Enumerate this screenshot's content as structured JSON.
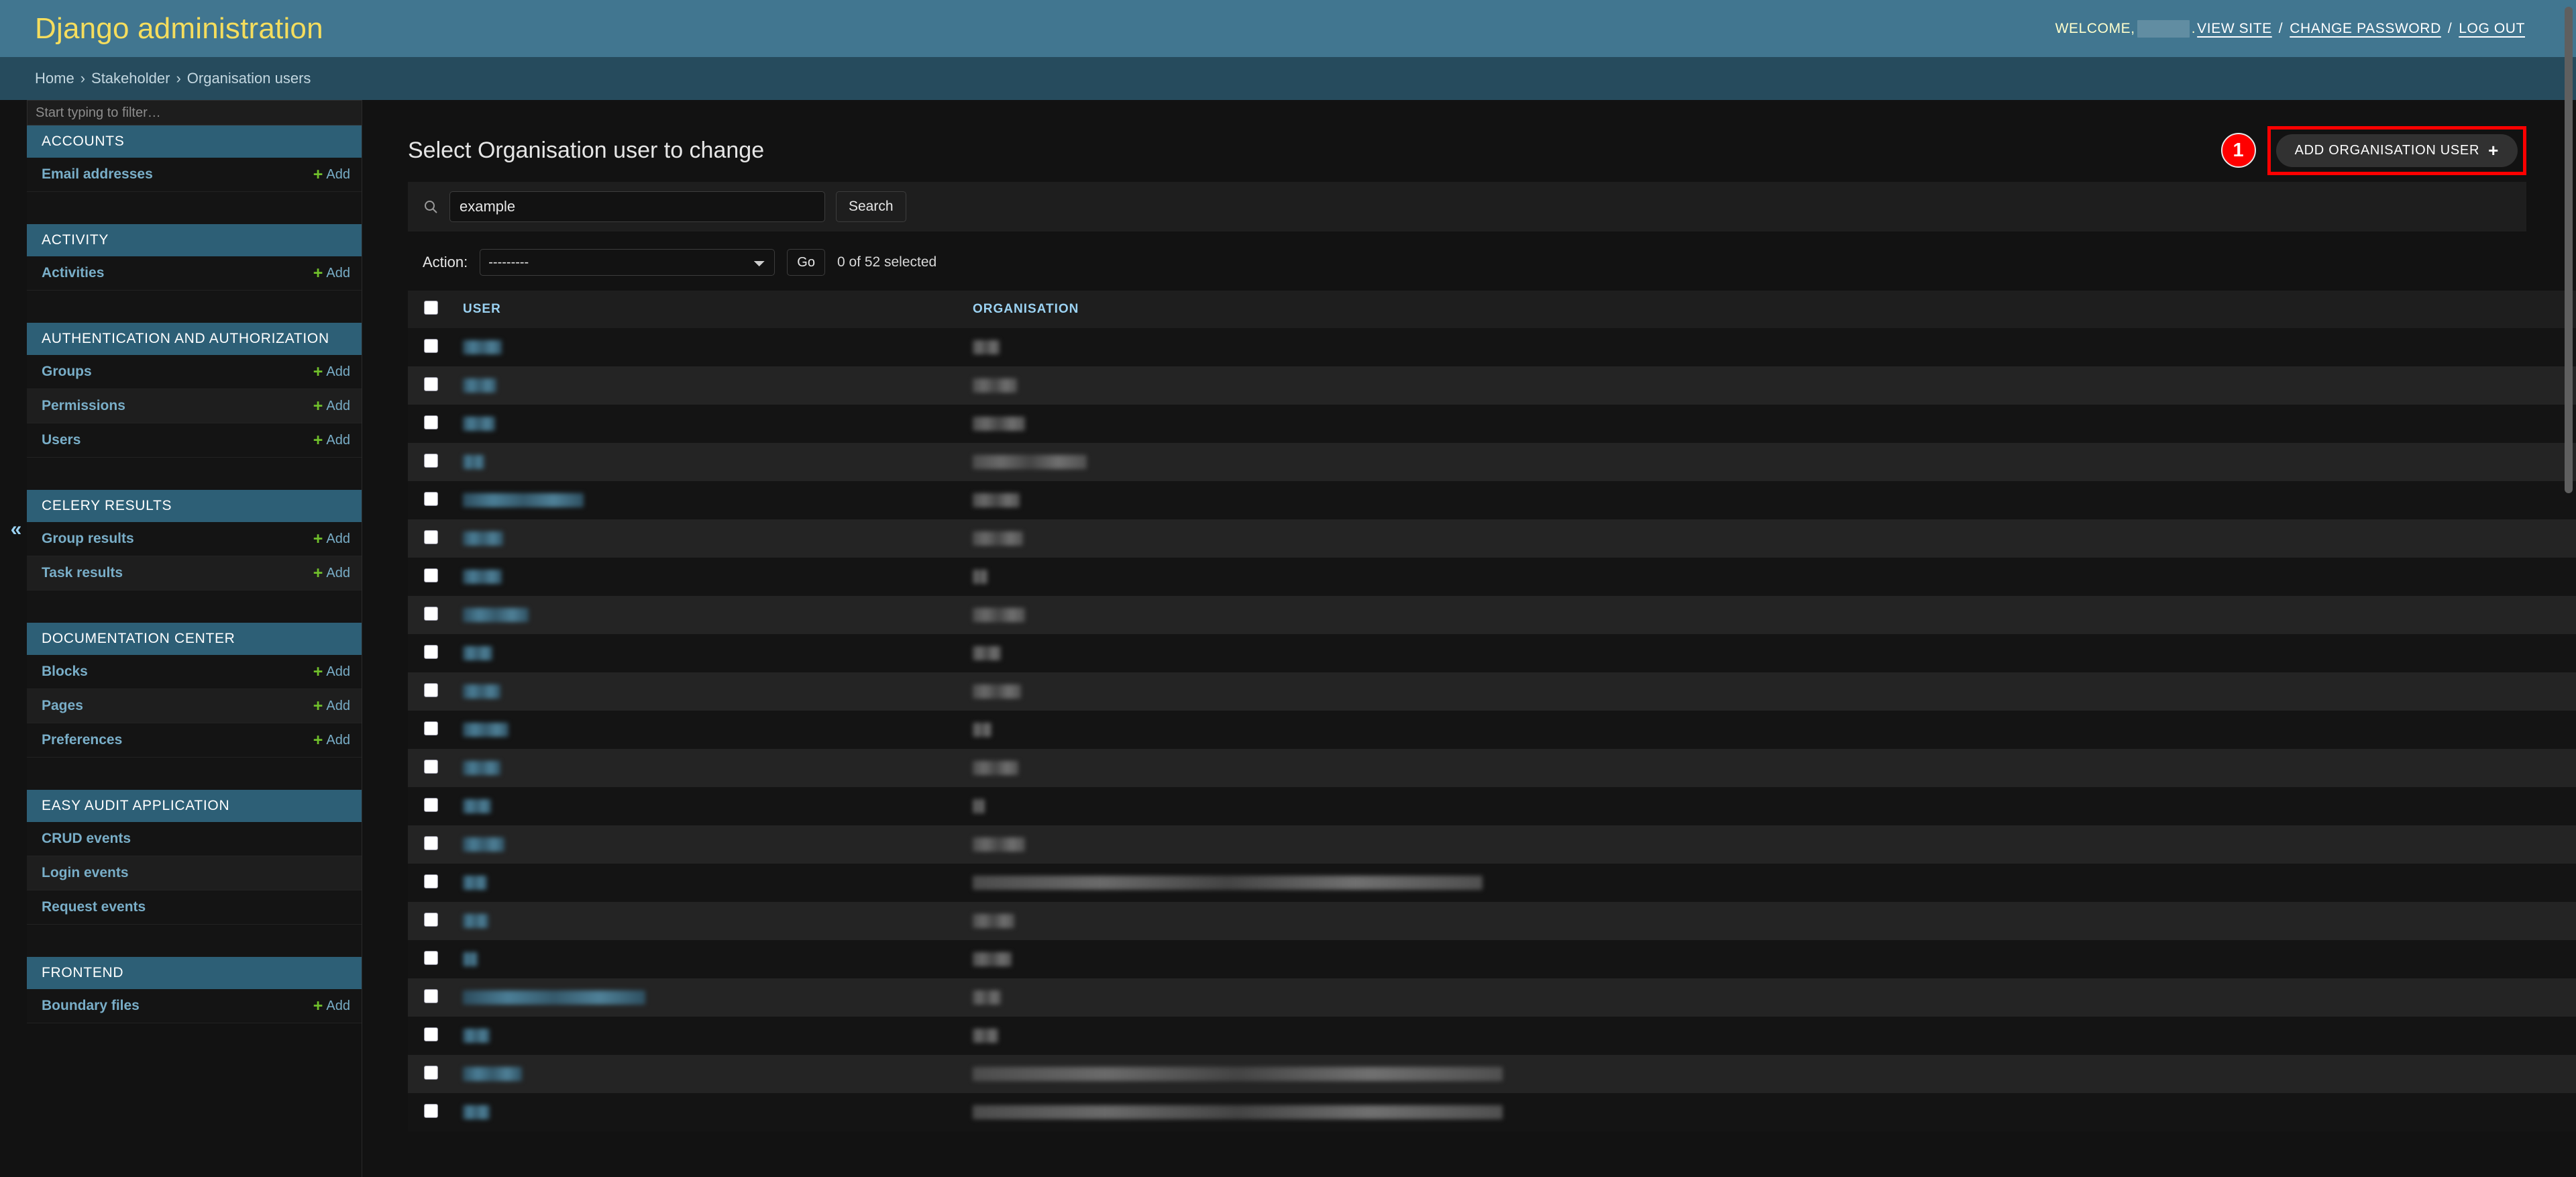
{
  "header": {
    "site_title": "Django administration",
    "welcome_text": "WELCOME,",
    "username_redacted": "",
    "view_site": "VIEW SITE",
    "change_password": "CHANGE PASSWORD",
    "log_out": "LOG OUT",
    "separator": "/",
    "brand_color": "#417690",
    "title_color": "#f5dd5d"
  },
  "breadcrumbs": {
    "home": "Home",
    "app": "Stakeholder",
    "current": "Organisation users",
    "separator": "›"
  },
  "sidebar": {
    "filter_placeholder": "Start typing to filter…",
    "filter_value": "",
    "collapse_icon": "«",
    "add_label": "Add",
    "plus_icon": "+",
    "apps": [
      {
        "caption": "ACCOUNTS",
        "models": [
          {
            "label": "Email addresses",
            "has_add": true
          }
        ]
      },
      {
        "caption": "ACTIVITY",
        "models": [
          {
            "label": "Activities",
            "has_add": true
          }
        ]
      },
      {
        "caption": "AUTHENTICATION AND AUTHORIZATION",
        "models": [
          {
            "label": "Groups",
            "has_add": true
          },
          {
            "label": "Permissions",
            "has_add": true
          },
          {
            "label": "Users",
            "has_add": true
          }
        ]
      },
      {
        "caption": "CELERY RESULTS",
        "models": [
          {
            "label": "Group results",
            "has_add": true
          },
          {
            "label": "Task results",
            "has_add": true
          }
        ]
      },
      {
        "caption": "DOCUMENTATION CENTER",
        "models": [
          {
            "label": "Blocks",
            "has_add": true
          },
          {
            "label": "Pages",
            "has_add": true
          },
          {
            "label": "Preferences",
            "has_add": true
          }
        ]
      },
      {
        "caption": "EASY AUDIT APPLICATION",
        "models": [
          {
            "label": "CRUD events",
            "has_add": false
          },
          {
            "label": "Login events",
            "has_add": false
          },
          {
            "label": "Request events",
            "has_add": false
          }
        ]
      },
      {
        "caption": "FRONTEND",
        "models": [
          {
            "label": "Boundary files",
            "has_add": true
          }
        ]
      }
    ]
  },
  "main": {
    "page_title": "Select Organisation user to change",
    "add_button_label": "ADD ORGANISATION USER",
    "add_button_plus": "+",
    "annotation_number": "1",
    "annotation_color": "#ff0000",
    "search": {
      "value": "example",
      "placeholder": "",
      "submit_label": "Search",
      "icon": "search-icon"
    },
    "actions": {
      "label": "Action:",
      "selected_option": "---------",
      "options": [
        "---------"
      ],
      "go_label": "Go",
      "counter": "0 of 52 selected"
    },
    "table": {
      "columns": [
        "USER",
        "ORGANISATION"
      ],
      "select_all_checked": false,
      "rows": [
        {
          "user_w": 58,
          "org_w": 40
        },
        {
          "user_w": 50,
          "org_w": 66
        },
        {
          "user_w": 48,
          "org_w": 78
        },
        {
          "user_w": 32,
          "org_w": 170
        },
        {
          "user_w": 180,
          "org_w": 70
        },
        {
          "user_w": 60,
          "org_w": 75
        },
        {
          "user_w": 58,
          "org_w": 22
        },
        {
          "user_w": 98,
          "org_w": 78
        },
        {
          "user_w": 44,
          "org_w": 42
        },
        {
          "user_w": 56,
          "org_w": 72
        },
        {
          "user_w": 68,
          "org_w": 28
        },
        {
          "user_w": 56,
          "org_w": 68
        },
        {
          "user_w": 42,
          "org_w": 18
        },
        {
          "user_w": 62,
          "org_w": 78
        },
        {
          "user_w": 36,
          "org_w": 760
        },
        {
          "user_w": 38,
          "org_w": 62
        },
        {
          "user_w": 22,
          "org_w": 58
        },
        {
          "user_w": 272,
          "org_w": 42
        },
        {
          "user_w": 40,
          "org_w": 38
        },
        {
          "user_w": 88,
          "org_w": 790
        },
        {
          "user_w": 40,
          "org_w": 790
        }
      ]
    }
  },
  "scrollbar": {
    "thumb_color": "#5f5f5f"
  }
}
